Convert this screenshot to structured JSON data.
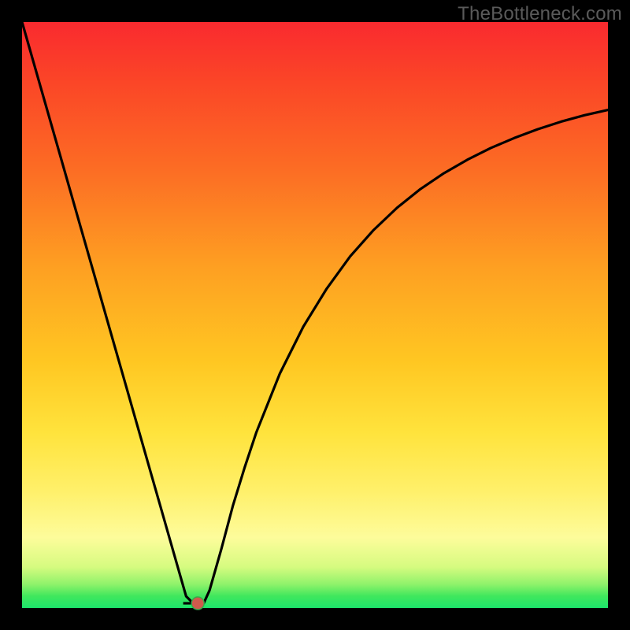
{
  "watermark": "TheBottleneck.com",
  "colors": {
    "frame": "#000000",
    "curve": "#000000",
    "dot_fill": "#cf5a4c",
    "dot_stroke": "#3aa74a"
  },
  "chart_data": {
    "type": "line",
    "title": "",
    "xlabel": "",
    "ylabel": "",
    "xlim": [
      0,
      100
    ],
    "ylim": [
      0,
      100
    ],
    "grid": false,
    "legend": false,
    "series": [
      {
        "name": "bottleneck-curve",
        "x": [
          0,
          2,
          4,
          6,
          8,
          10,
          12,
          14,
          16,
          18,
          20,
          22,
          24,
          26,
          27,
          28,
          29,
          30,
          30.5,
          31,
          32,
          34,
          36,
          38,
          40,
          44,
          48,
          52,
          56,
          60,
          64,
          68,
          72,
          76,
          80,
          84,
          88,
          92,
          96,
          100
        ],
        "y": [
          100,
          93,
          86,
          79,
          72,
          65,
          58,
          51,
          44,
          37,
          30,
          23,
          16,
          9,
          5.5,
          2,
          1,
          0.8,
          0.8,
          0.8,
          3,
          10,
          17.5,
          24,
          30,
          40,
          48,
          54.5,
          60,
          64.5,
          68.3,
          71.5,
          74.2,
          76.5,
          78.5,
          80.2,
          81.7,
          83,
          84.1,
          85
        ]
      }
    ],
    "minimum_marker": {
      "x": 30,
      "y": 0.8
    },
    "flat_segment": {
      "x_start": 27.5,
      "x_end": 30.5,
      "y": 0.8
    }
  }
}
